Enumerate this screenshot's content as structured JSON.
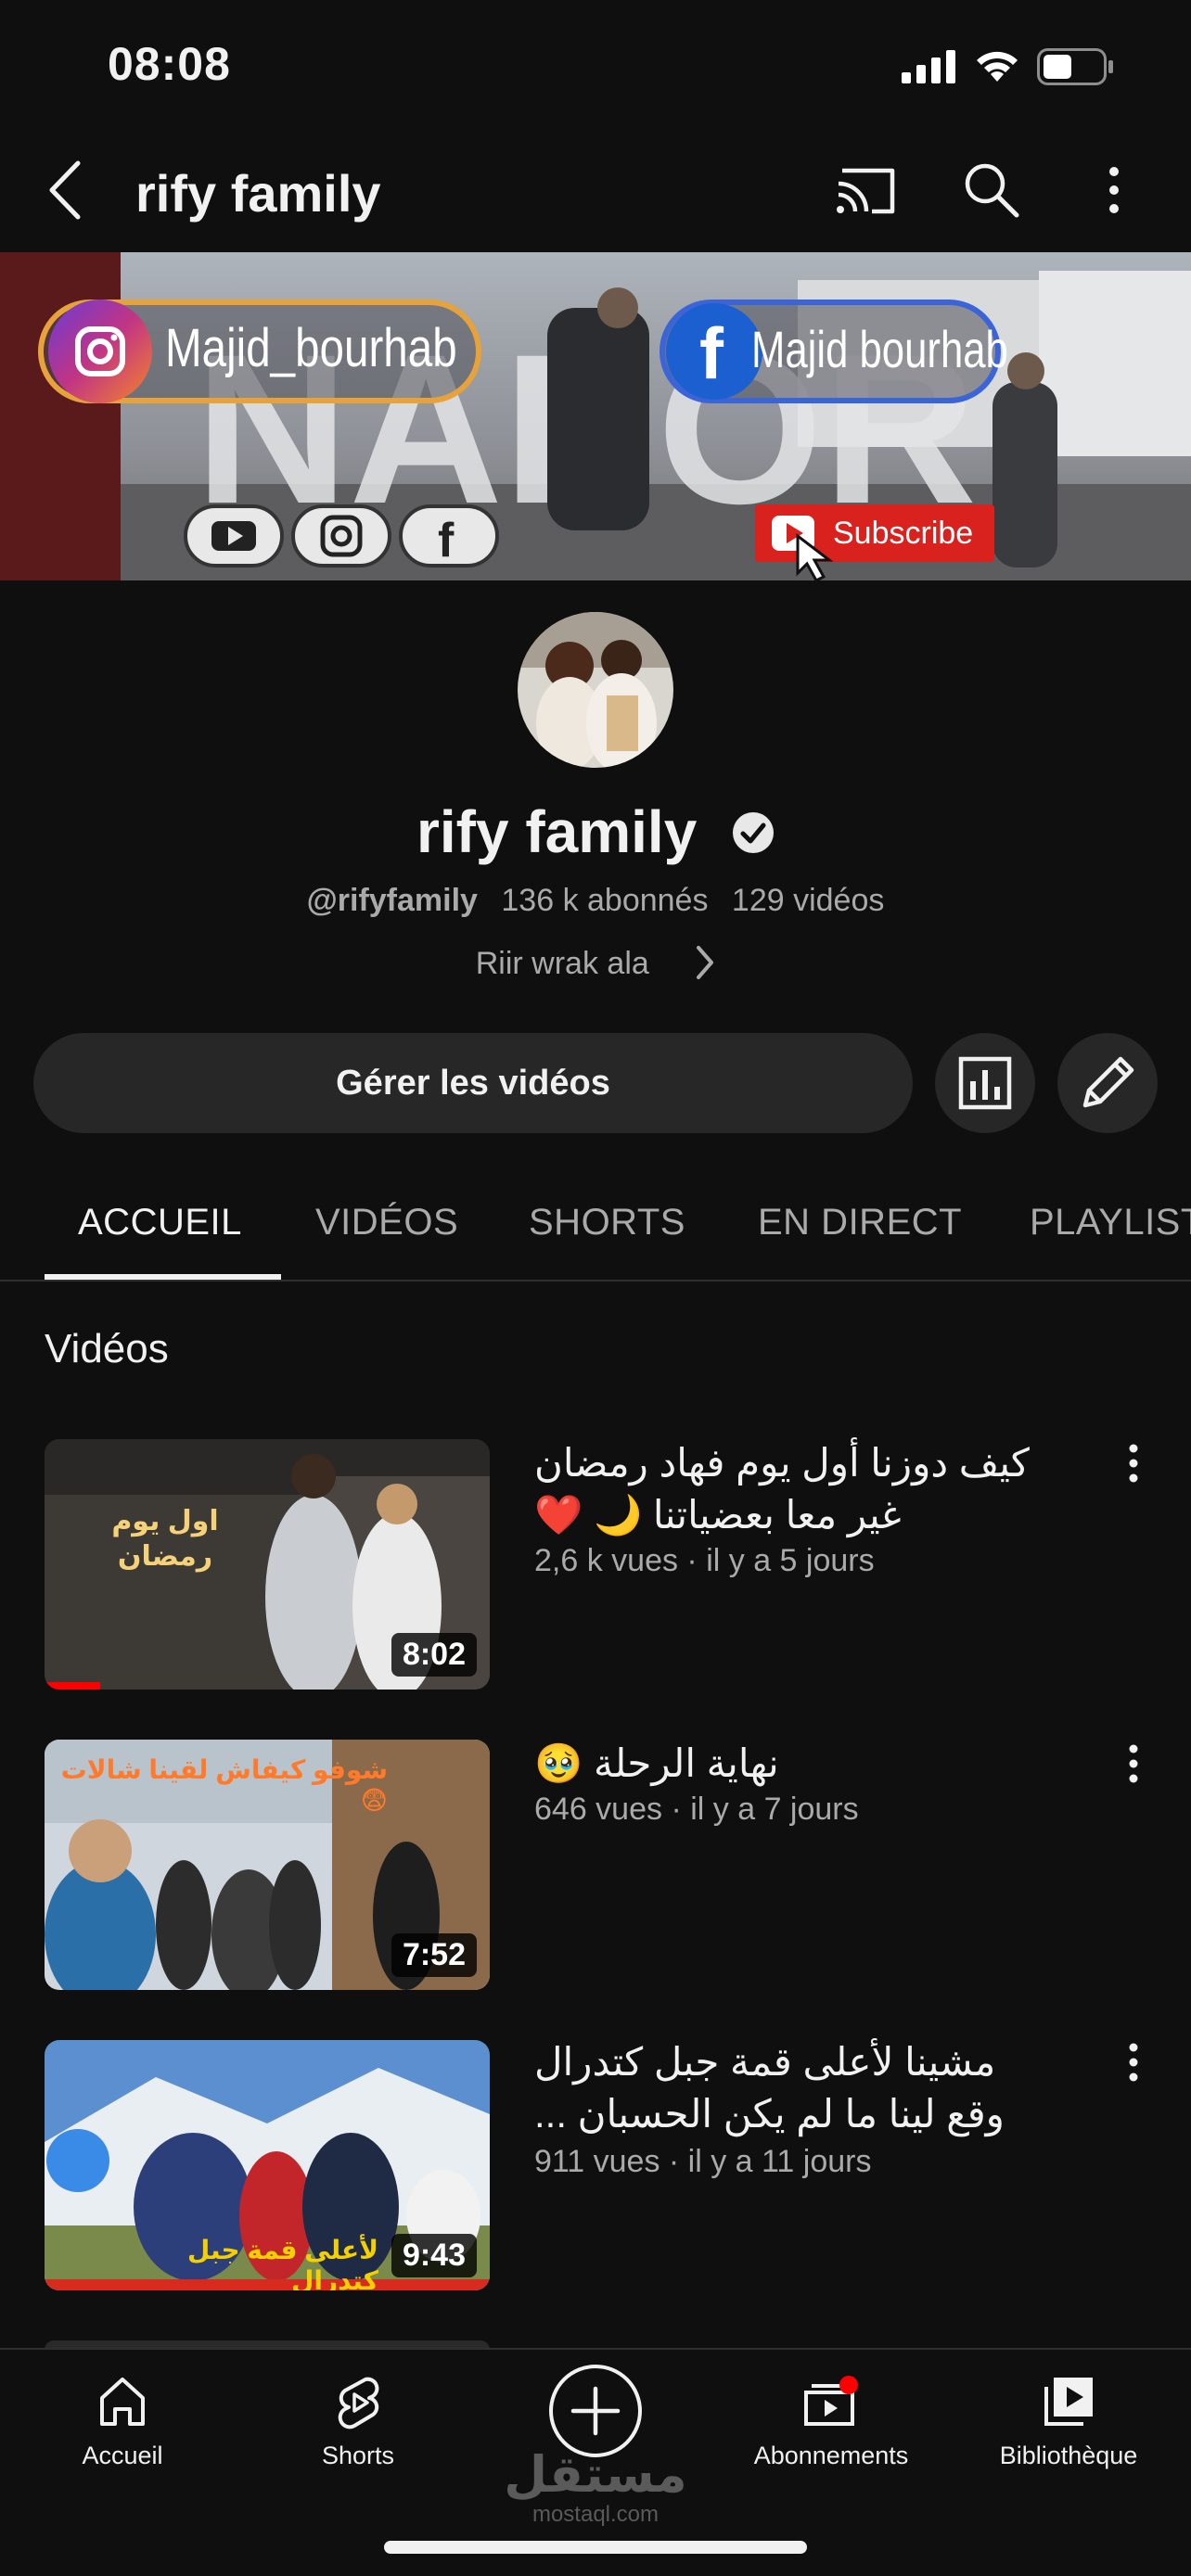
{
  "status_bar": {
    "time": "08:08"
  },
  "header": {
    "title": "rify family"
  },
  "banner": {
    "instagram_handle": "Majid_bourhab",
    "facebook_name": "Majid bourhab",
    "subscribe_label": "Subscribe",
    "backdrop_text": "NADOR",
    "colors": {
      "subscribe": "#d9211e",
      "instagram": "#b73ab1",
      "facebook": "#1b5fd1"
    }
  },
  "channel": {
    "name": "rify family",
    "handle": "@rifyfamily",
    "subscribers": "136 k abonnés",
    "videos_count": "129 vidéos",
    "description": "Riir wrak ala"
  },
  "actions": {
    "manage_label": "Gérer les vidéos"
  },
  "tabs": [
    {
      "label": "ACCUEIL",
      "active": true
    },
    {
      "label": "VIDÉOS",
      "active": false
    },
    {
      "label": "SHORTS",
      "active": false
    },
    {
      "label": "EN DIRECT",
      "active": false
    },
    {
      "label": "PLAYLISTS",
      "active": false
    }
  ],
  "section": {
    "title": "Vidéos"
  },
  "videos": [
    {
      "title_line1": "كيف دوزنا أول يوم فهاد رمضان",
      "title_line2": "غير معا بعضياتنا 🌙 ❤️",
      "meta": "2,6 k vues · il y a 5 jours",
      "duration": "8:02",
      "thumb_text": "اول يوم رمضان"
    },
    {
      "title_line1": "نهاية الرحلة 🥹",
      "title_line2": "",
      "meta": "646 vues · il y a 7 jours",
      "duration": "7:52",
      "thumb_text": "شوفو كيفاش لقينا شالات 😨"
    },
    {
      "title_line1": "مشينا لأعلى قمة جبل كتدرال",
      "title_line2": "وقع لينا ما لم يكن الحسبان ...",
      "meta": "911 vues · il y a 11 jours",
      "duration": "9:43",
      "thumb_text": "لأعلى قمة جبل كتدرال"
    }
  ],
  "bottom_nav": [
    {
      "label": "Accueil",
      "icon": "home-icon"
    },
    {
      "label": "Shorts",
      "icon": "shorts-icon"
    },
    {
      "label": "",
      "icon": "create-plus-icon"
    },
    {
      "label": "Abonnements",
      "icon": "subscriptions-icon"
    },
    {
      "label": "Bibliothèque",
      "icon": "library-icon"
    }
  ],
  "watermark": {
    "arabic": "مستقل",
    "latin": "mostaql.com"
  }
}
